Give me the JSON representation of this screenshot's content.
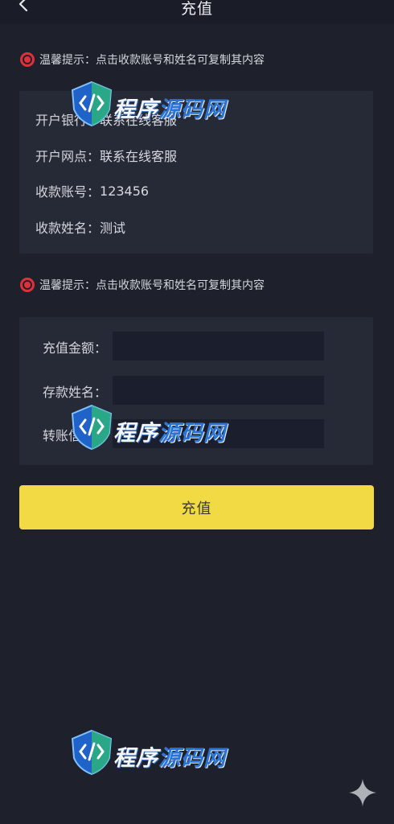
{
  "header": {
    "title": "充值",
    "back_icon": "chevron-left-icon"
  },
  "tips": [
    {
      "icon": "target-circle-icon",
      "text": "温馨提示：点击收款账号和姓名可复制其内容"
    },
    {
      "icon": "target-circle-icon",
      "text": "温馨提示：点击收款账号和姓名可复制其内容"
    }
  ],
  "bank_info": {
    "bank": {
      "label": "开户银行：",
      "value": "联系在线客服"
    },
    "branch": {
      "label": "开户网点：",
      "value": "联系在线客服"
    },
    "account": {
      "label": "收款账号：",
      "value": "123456"
    },
    "name": {
      "label": "收款姓名：",
      "value": "测试"
    }
  },
  "form": {
    "amount": {
      "label": "充值金额：",
      "value": "",
      "placeholder": ""
    },
    "depositor": {
      "label": "存款姓名：",
      "value": "",
      "placeholder": ""
    },
    "transfer": {
      "label": "转账信息：",
      "value": "",
      "placeholder": ""
    }
  },
  "submit_label": "充值",
  "watermark": {
    "part1": "程序",
    "part2": "源码网",
    "icon": "code-shield-icon"
  },
  "colors": {
    "background": "#1e202b",
    "card": "#262936",
    "input": "#1b1e2c",
    "accent": "#f1da43",
    "tip_icon": "#e0313a",
    "watermark_blue": "#2a74d6"
  },
  "corner_icon": "sparkle-icon"
}
